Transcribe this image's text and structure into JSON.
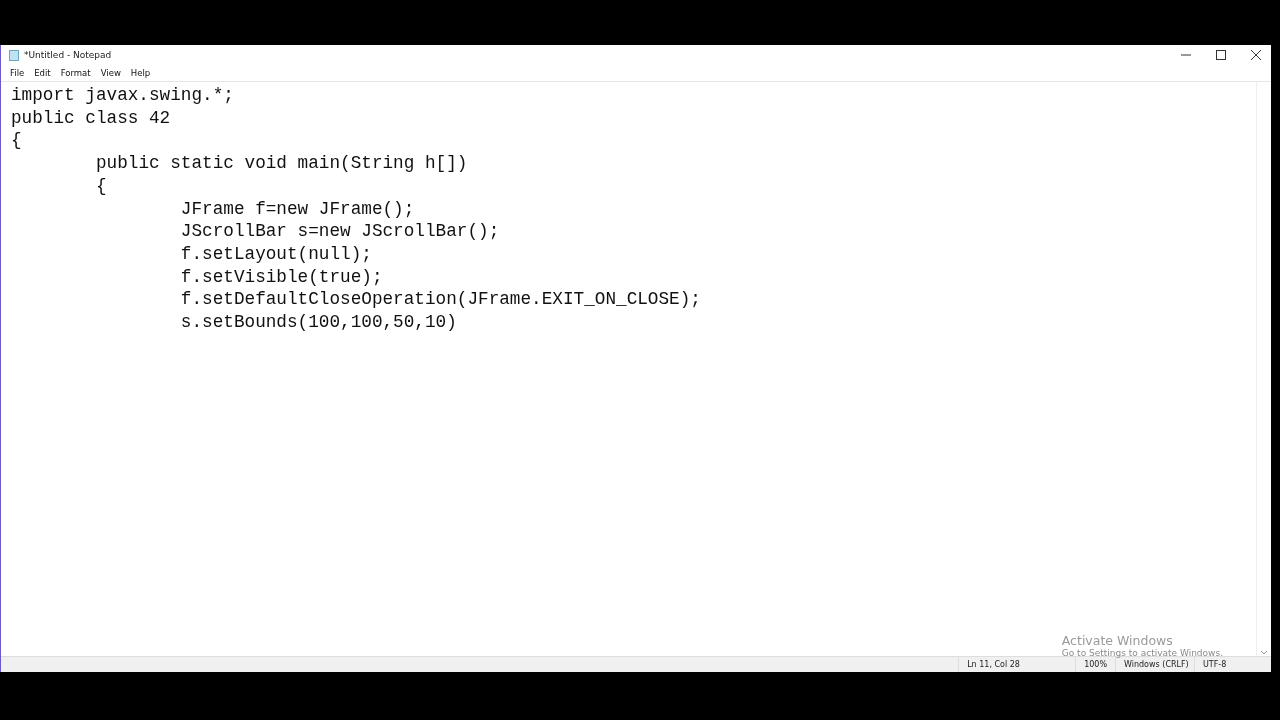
{
  "window": {
    "title": "*Untitled - Notepad"
  },
  "menu": [
    "File",
    "Edit",
    "Format",
    "View",
    "Help"
  ],
  "editor": {
    "lines": [
      "import javax.swing.*;",
      "public class 42",
      "{",
      "\tpublic static void main(String h[])",
      "\t{",
      "\t\tJFrame f=new JFrame();",
      "\t\tJScrollBar s=new JScrollBar();",
      "\t\tf.setLayout(null);",
      "\t\tf.setVisible(true);",
      "\t\tf.setDefaultCloseOperation(JFrame.EXIT_ON_CLOSE);",
      "\t\ts.setBounds(100,100,50,10)"
    ]
  },
  "activation_notice": {
    "title": "Activate Windows",
    "subtitle": "Go to Settings to activate Windows."
  },
  "status_bar": [
    "Ln 11, Col 28",
    "100%",
    "Windows (CRLF)",
    "UTF-8"
  ]
}
